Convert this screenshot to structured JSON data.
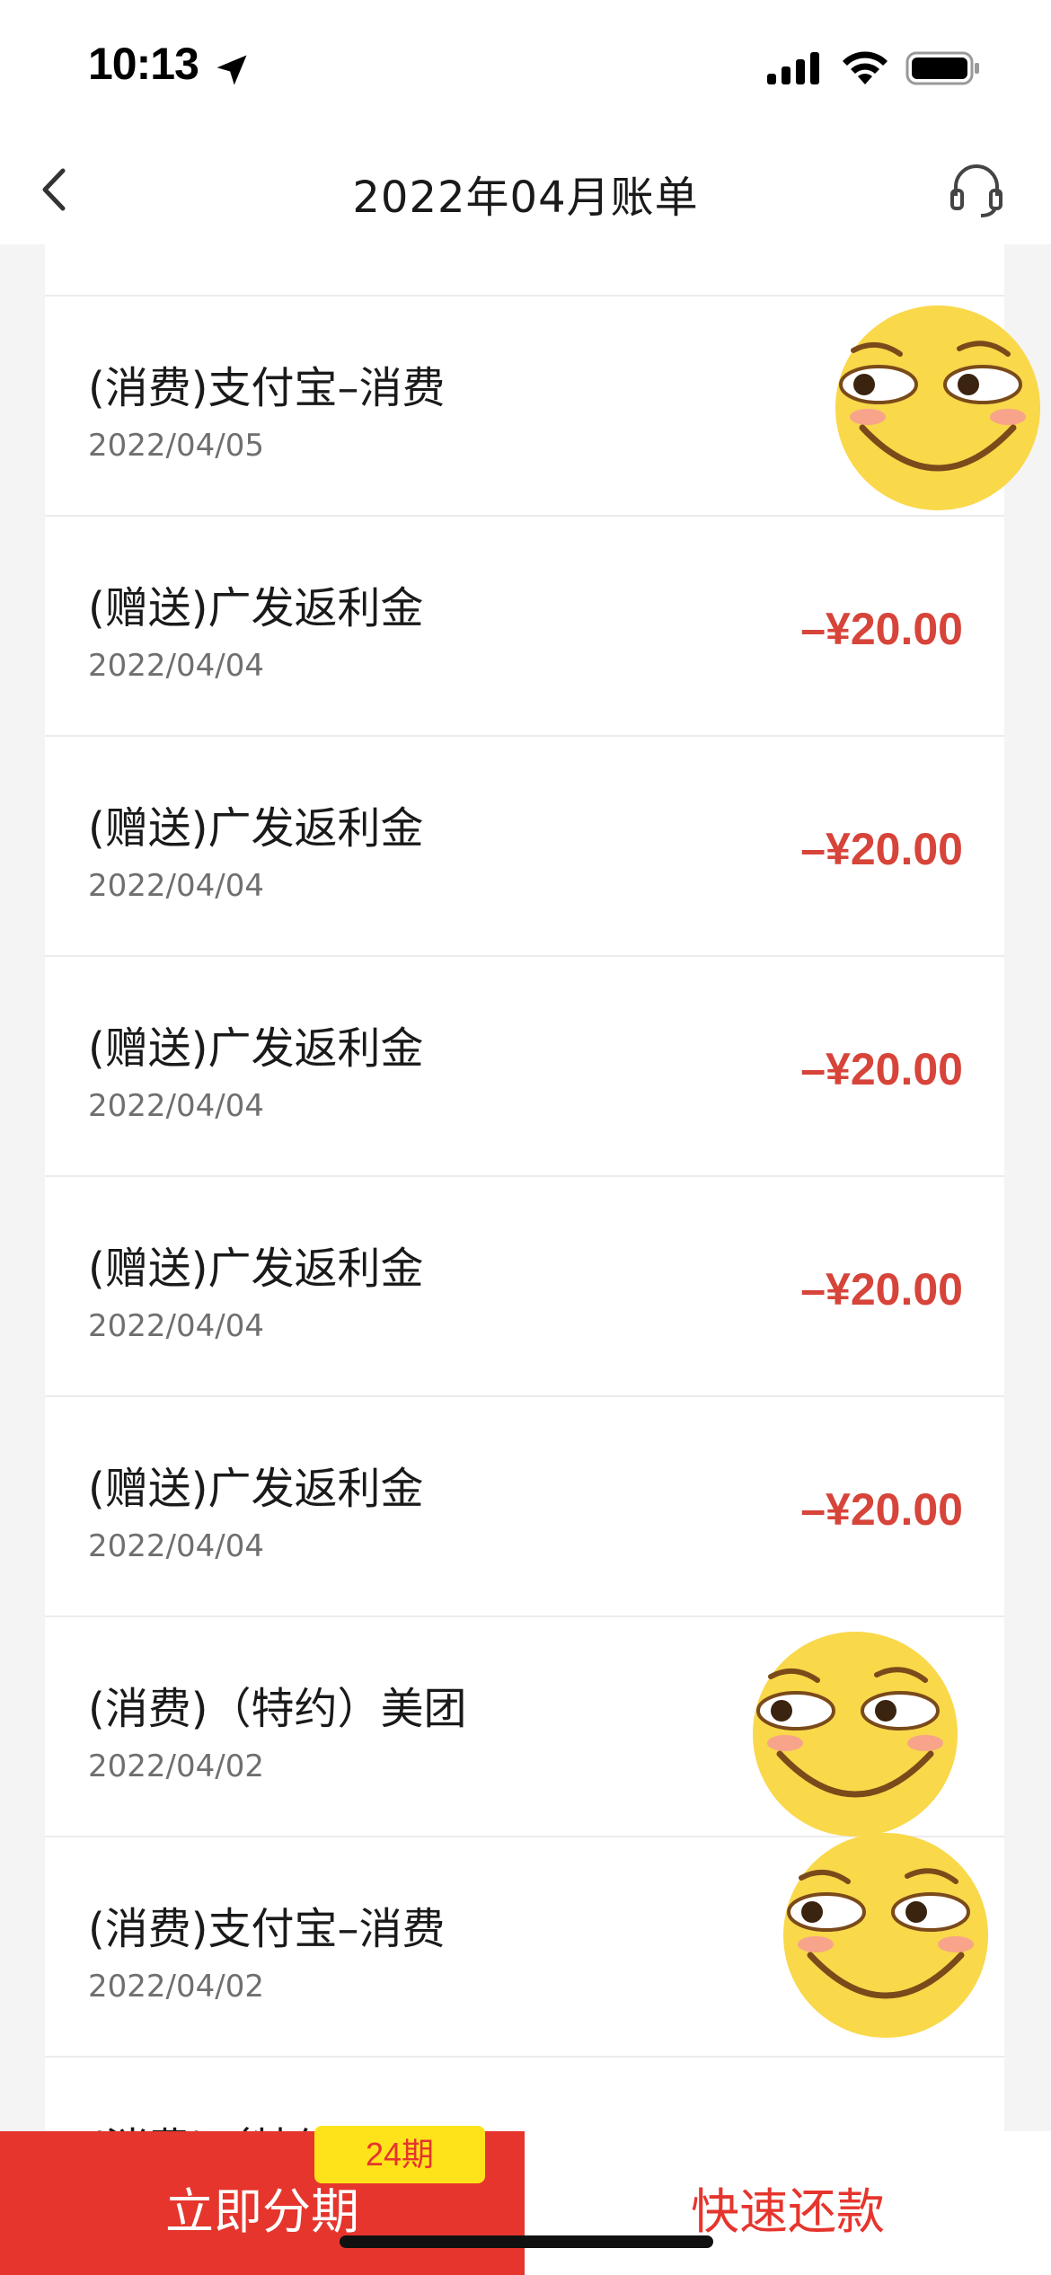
{
  "status_bar": {
    "time": "10:13",
    "icons": [
      "location-arrow-icon",
      "cellular-signal-icon",
      "wifi-icon",
      "battery-icon"
    ]
  },
  "nav": {
    "back_icon": "chevron-left-icon",
    "title": "2022年04月账单",
    "service_icon": "headset-icon"
  },
  "transactions": [
    {
      "title": "(消费)支付宝–消费",
      "date": "2022/04/05",
      "amount": ""
    },
    {
      "title": "(赠送)广发返利金",
      "date": "2022/04/04",
      "amount": "–¥20.00"
    },
    {
      "title": "(赠送)广发返利金",
      "date": "2022/04/04",
      "amount": "–¥20.00"
    },
    {
      "title": "(赠送)广发返利金",
      "date": "2022/04/04",
      "amount": "–¥20.00"
    },
    {
      "title": "(赠送)广发返利金",
      "date": "2022/04/04",
      "amount": "–¥20.00"
    },
    {
      "title": "(赠送)广发返利金",
      "date": "2022/04/04",
      "amount": "–¥20.00"
    },
    {
      "title": "(消费)（特约）美团",
      "date": "2022/04/02",
      "amount": ""
    },
    {
      "title": "(消费)支付宝–消费",
      "date": "2022/04/02",
      "amount": ""
    },
    {
      "title": "(消费)（特约）美团",
      "date": "",
      "amount": ""
    }
  ],
  "bottom_bar": {
    "installment_label": "立即分期",
    "installment_badge": "24期",
    "repay_label": "快速还款"
  },
  "colors": {
    "accent_red": "#e5352d",
    "amount_red": "#d6443a",
    "badge_yellow": "#ffe31a"
  }
}
